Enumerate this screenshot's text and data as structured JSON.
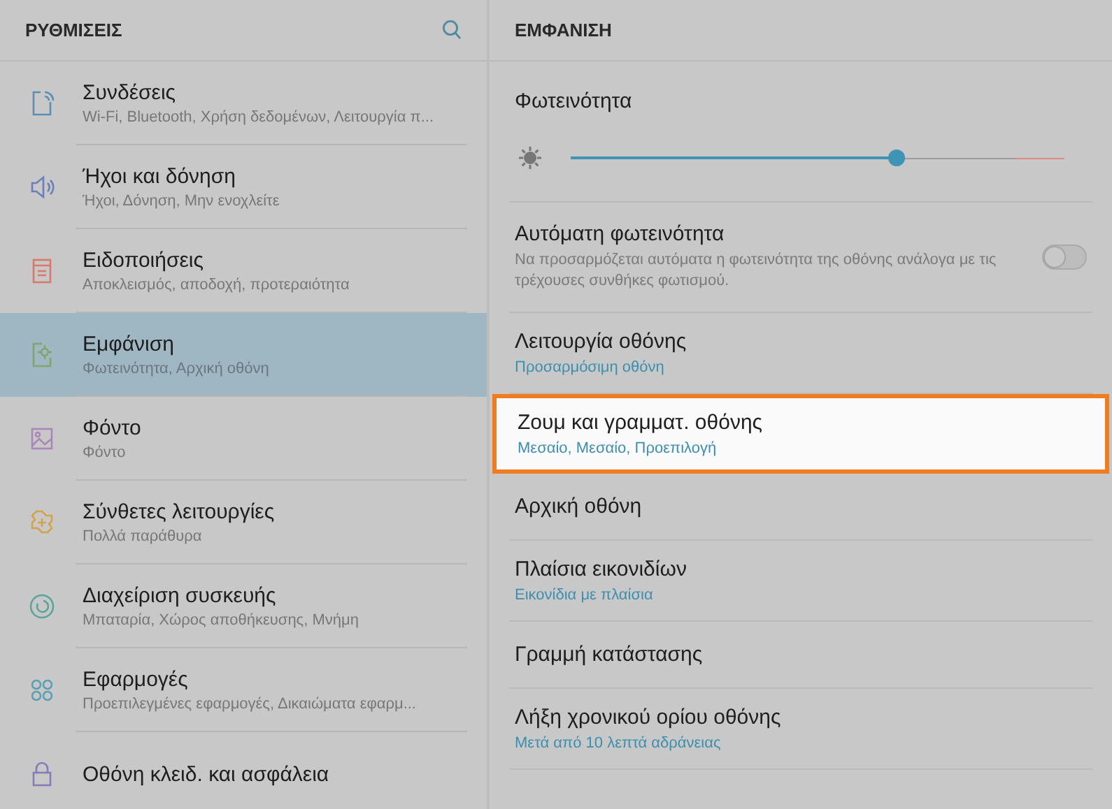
{
  "sidebar": {
    "title": "ΡΥΘΜΙΣΕΙΣ",
    "items": [
      {
        "label": "Συνδέσεις",
        "sublabel": "Wi-Fi, Bluetooth, Χρήση δεδομένων, Λειτουργία π...",
        "selected": false
      },
      {
        "label": "Ήχοι και δόνηση",
        "sublabel": "Ήχοι, Δόνηση, Μην ενοχλείτε",
        "selected": false
      },
      {
        "label": "Ειδοποιήσεις",
        "sublabel": "Αποκλεισμός, αποδοχή, προτεραιότητα",
        "selected": false
      },
      {
        "label": "Εμφάνιση",
        "sublabel": "Φωτεινότητα, Αρχική οθόνη",
        "selected": true
      },
      {
        "label": "Φόντο",
        "sublabel": "Φόντο",
        "selected": false
      },
      {
        "label": "Σύνθετες λειτουργίες",
        "sublabel": "Πολλά παράθυρα",
        "selected": false
      },
      {
        "label": "Διαχείριση συσκευής",
        "sublabel": "Μπαταρία, Χώρος αποθήκευσης, Μνήμη",
        "selected": false
      },
      {
        "label": "Εφαρμογές",
        "sublabel": "Προεπιλεγμένες εφαρμογές, Δικαιώματα εφαρμ...",
        "selected": false
      },
      {
        "label": "Οθόνη κλειδ. και ασφάλεια",
        "selected": false
      }
    ]
  },
  "panel": {
    "title": "ΕΜΦΑΝΙΣΗ",
    "items": [
      {
        "kind": "slider",
        "label": "Φωτεινότητα",
        "level": 0.66
      },
      {
        "kind": "toggle",
        "label": "Αυτόματη φωτεινότητα",
        "description": "Να προσαρμόζεται αυτόματα η φωτεινότητα της οθόνης ανάλογα με τις τρέχουσες συνθήκες φωτισμού.",
        "on": false
      },
      {
        "kind": "option",
        "label": "Λειτουργία οθόνης",
        "value": "Προσαρμόσιμη οθόνη",
        "highlighted": false
      },
      {
        "kind": "option",
        "label": "Ζουμ και γραμματ. οθόνης",
        "value": "Μεσαίο, Μεσαίο, Προεπιλογή",
        "highlighted": true
      },
      {
        "kind": "option",
        "label": "Αρχική οθόνη",
        "highlighted": false
      },
      {
        "kind": "option",
        "label": "Πλαίσια εικονιδίων",
        "value": "Εικονίδια με πλαίσια",
        "highlighted": false
      },
      {
        "kind": "option",
        "label": "Γραμμή κατάστασης",
        "highlighted": false
      },
      {
        "kind": "option",
        "label": "Λήξη χρονικού ορίου οθόνης",
        "value": "Μετά από 10 λεπτά αδράνειας",
        "highlighted": false
      }
    ]
  }
}
